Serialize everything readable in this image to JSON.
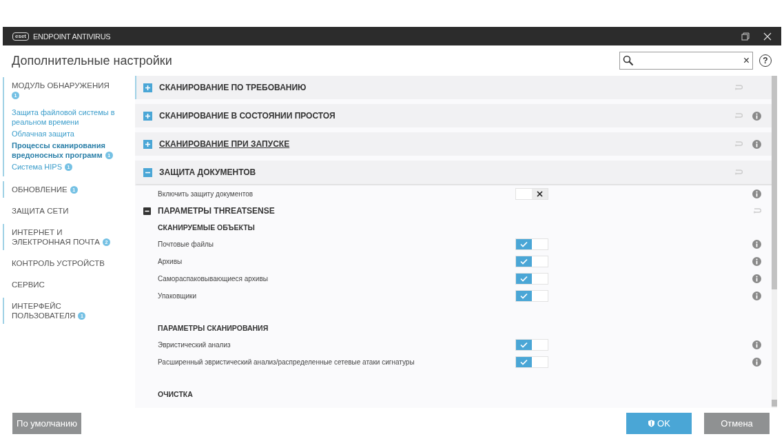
{
  "window": {
    "logo": "eset",
    "title": "ENDPOINT ANTIVIRUS"
  },
  "header": {
    "title": "Дополнительные настройки",
    "clear": "×",
    "help": "?"
  },
  "sidebar": {
    "items": [
      {
        "label": "МОДУЛЬ ОБНАРУЖЕНИЯ",
        "badge": "1",
        "expandable": true,
        "children": [
          {
            "label": "Защита файловой системы в реальном времени",
            "selected": false
          },
          {
            "label": "Облачная защита",
            "selected": false
          },
          {
            "label": "Процессы сканирования вредоносных программ",
            "badge": "1",
            "selected": true
          },
          {
            "label": "Система HIPS",
            "badge": "1",
            "selected": false
          }
        ]
      },
      {
        "label": "ОБНОВЛЕНИЕ",
        "badge": "1",
        "expandable": true
      },
      {
        "label": "ЗАЩИТА СЕТИ",
        "expandable": false
      },
      {
        "label": "ИНТЕРНЕТ И ЭЛЕКТРОННАЯ ПОЧТА",
        "badge": "2",
        "expandable": true
      },
      {
        "label": "КОНТРОЛЬ УСТРОЙСТВ",
        "expandable": false
      },
      {
        "label": "СЕРВИС",
        "expandable": false
      },
      {
        "label": "ИНТЕРФЕЙС ПОЛЬЗОВАТЕЛЯ",
        "badge": "1",
        "expandable": true
      }
    ]
  },
  "content": {
    "rows": [
      {
        "kind": "section",
        "label": "СКАНИРОВАНИЕ ПО ТРЕБОВАНИЮ",
        "expanded": false,
        "hovered": false,
        "info": false
      },
      {
        "kind": "section",
        "label": "СКАНИРОВАНИЕ В СОСТОЯНИИ ПРОСТОЯ",
        "expanded": false,
        "hovered": false,
        "info": true
      },
      {
        "kind": "section",
        "label": "СКАНИРОВАНИЕ ПРИ ЗАПУСКЕ",
        "expanded": false,
        "hovered": true,
        "info": true
      },
      {
        "kind": "section",
        "label": "ЗАЩИТА ДОКУМЕНТОВ",
        "expanded": true,
        "hovered": false,
        "info": false
      },
      {
        "kind": "toggle",
        "label": "Включить защиту документов",
        "on": false
      },
      {
        "kind": "subsection",
        "label": "ПАРАМЕТРЫ THREATSENSE"
      },
      {
        "kind": "heading",
        "label": "СКАНИРУЕМЫЕ ОБЪЕКТЫ",
        "spaced": false
      },
      {
        "kind": "toggle",
        "label": "Почтовые файлы",
        "on": true
      },
      {
        "kind": "toggle",
        "label": "Архивы",
        "on": true
      },
      {
        "kind": "toggle",
        "label": "Самораспаковывающиеся архивы",
        "on": true
      },
      {
        "kind": "toggle",
        "label": "Упаковщики",
        "on": true
      },
      {
        "kind": "heading",
        "label": "ПАРАМЕТРЫ СКАНИРОВАНИЯ",
        "spaced": true
      },
      {
        "kind": "toggle",
        "label": "Эвристический анализ",
        "on": true
      },
      {
        "kind": "toggle",
        "label": "Расширенный эвристический анализ/распределенные сетевые атаки сигнатуры",
        "on": true
      },
      {
        "kind": "heading",
        "label": "ОЧИСТКА",
        "spaced": true
      }
    ]
  },
  "footer": {
    "default": "По умолчанию",
    "ok": "OK",
    "cancel": "Отмена"
  }
}
